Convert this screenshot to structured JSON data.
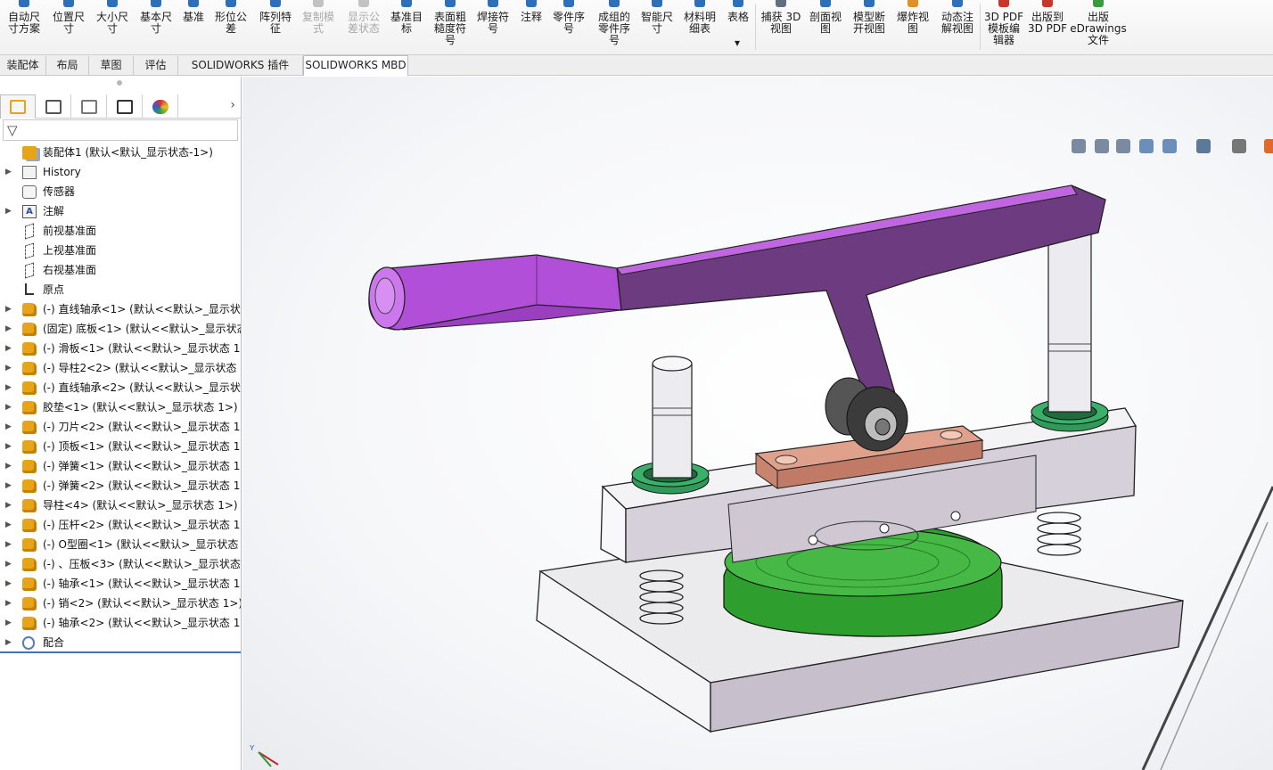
{
  "ribbon": {
    "buttons": [
      {
        "label": "自动尺\n寸方案",
        "icon": "auto-dimension-icon",
        "enabled": true
      },
      {
        "label": "位置尺\n寸",
        "icon": "location-dimension-icon",
        "enabled": true
      },
      {
        "label": "大小尺\n寸",
        "icon": "size-dimension-icon",
        "enabled": true
      },
      {
        "label": "基本尺\n寸",
        "icon": "basic-dimension-icon",
        "enabled": true
      },
      {
        "label": "基准",
        "icon": "datum-icon",
        "enabled": true
      },
      {
        "label": "形位公\n差",
        "icon": "geometric-tolerance-icon",
        "enabled": true
      },
      {
        "label": "阵列特\n征",
        "icon": "pattern-feature-icon",
        "enabled": true
      },
      {
        "label": "复制模\n式",
        "icon": "copy-scheme-icon",
        "enabled": false
      },
      {
        "label": "显示公\n差状态",
        "icon": "tolerance-status-icon",
        "enabled": false
      },
      {
        "label": "基准目\n标",
        "icon": "datum-target-icon",
        "enabled": true
      },
      {
        "label": "表面粗\n糙度符\n号",
        "icon": "surface-finish-icon",
        "enabled": true
      },
      {
        "label": "焊接符\n号",
        "icon": "weld-symbol-icon",
        "enabled": true
      },
      {
        "label": "注释",
        "icon": "note-icon",
        "enabled": true
      },
      {
        "label": "零件序\n号",
        "icon": "balloon-icon",
        "enabled": true
      },
      {
        "label": "成组的\n零件序\n号",
        "icon": "stacked-balloon-icon",
        "enabled": true
      },
      {
        "label": "智能尺\n寸",
        "icon": "smart-dimension-icon",
        "enabled": true
      },
      {
        "label": "材料明\n细表",
        "icon": "bom-icon",
        "enabled": true
      },
      {
        "label": "表格",
        "icon": "table-icon",
        "enabled": true
      },
      {
        "label": "捕获 3D\n视图",
        "icon": "capture-3d-view-icon",
        "enabled": true
      },
      {
        "label": "剖面视\n图",
        "icon": "section-view-icon",
        "enabled": true
      },
      {
        "label": "模型断\n开视图",
        "icon": "model-break-view-icon",
        "enabled": true
      },
      {
        "label": "爆炸视\n图",
        "icon": "exploded-view-icon",
        "enabled": true
      },
      {
        "label": "动态注\n解视图",
        "icon": "dynamic-annotation-view-icon",
        "enabled": true
      },
      {
        "label": "3D PDF\n模板编\n辑器",
        "icon": "pdf-template-editor-icon",
        "enabled": true
      },
      {
        "label": "出版到\n3D PDF",
        "icon": "publish-3d-pdf-icon",
        "enabled": true
      },
      {
        "label": "出版\neDrawings\n文件",
        "icon": "edrawings-icon",
        "enabled": true
      }
    ],
    "table_dropdown": "▾"
  },
  "tabs": [
    {
      "label": "装配体",
      "active": false
    },
    {
      "label": "布局",
      "active": false
    },
    {
      "label": "草图",
      "active": false
    },
    {
      "label": "评估",
      "active": false
    },
    {
      "label": "SOLIDWORKS 插件",
      "active": false
    },
    {
      "label": "SOLIDWORKS MBD",
      "active": true
    }
  ],
  "panel": {
    "tabs": [
      "feature-manager-icon",
      "property-manager-icon",
      "configuration-manager-icon",
      "dimxpert-manager-icon",
      "display-manager-icon"
    ],
    "more": "›",
    "filter_icon": "filter-icon"
  },
  "tree": [
    {
      "label": "装配体1  (默认<默认_显示状态-1>)",
      "icon": "asm",
      "expander": ""
    },
    {
      "label": "History",
      "icon": "folder",
      "expander": "▶"
    },
    {
      "label": "传感器",
      "icon": "sensor",
      "expander": ""
    },
    {
      "label": "注解",
      "icon": "annot",
      "expander": "▶"
    },
    {
      "label": "前视基准面",
      "icon": "plane",
      "expander": ""
    },
    {
      "label": "上视基准面",
      "icon": "plane",
      "expander": ""
    },
    {
      "label": "右视基准面",
      "icon": "plane",
      "expander": ""
    },
    {
      "label": "原点",
      "icon": "origin",
      "expander": ""
    },
    {
      "label": "(-) 直线轴承<1> (默认<<默认>_显示状态",
      "icon": "part",
      "expander": "▶"
    },
    {
      "label": "(固定) 底板<1> (默认<<默认>_显示状态",
      "icon": "part",
      "expander": "▶"
    },
    {
      "label": "(-) 滑板<1> (默认<<默认>_显示状态 1>",
      "icon": "part",
      "expander": "▶"
    },
    {
      "label": "(-) 导柱2<2> (默认<<默认>_显示状态 1",
      "icon": "part",
      "expander": "▶"
    },
    {
      "label": "(-) 直线轴承<2> (默认<<默认>_显示状态",
      "icon": "part",
      "expander": "▶"
    },
    {
      "label": "胶垫<1> (默认<<默认>_显示状态 1>)",
      "icon": "part",
      "expander": "▶"
    },
    {
      "label": "(-) 刀片<2> (默认<<默认>_显示状态 1>",
      "icon": "part",
      "expander": "▶"
    },
    {
      "label": "(-) 顶板<1> (默认<<默认>_显示状态 1>",
      "icon": "part",
      "expander": "▶"
    },
    {
      "label": "(-) 弹簧<1> (默认<<默认>_显示状态 1>",
      "icon": "part",
      "expander": "▶"
    },
    {
      "label": "(-) 弹簧<2> (默认<<默认>_显示状态 1>",
      "icon": "part",
      "expander": "▶"
    },
    {
      "label": "导柱<4> (默认<<默认>_显示状态 1>)",
      "icon": "part",
      "expander": "▶"
    },
    {
      "label": "(-) 压杆<2> (默认<<默认>_显示状态 1>",
      "icon": "part",
      "expander": "▶"
    },
    {
      "label": "(-) O型圈<1> (默认<<默认>_显示状态 1",
      "icon": "part",
      "expander": "▶"
    },
    {
      "label": "(-) 、压板<3> (默认<<默认>_显示状态 1",
      "icon": "part",
      "expander": "▶"
    },
    {
      "label": "(-) 轴承<1> (默认<<默认>_显示状态 1>",
      "icon": "part",
      "expander": "▶"
    },
    {
      "label": "(-) 销<2> (默认<<默认>_显示状态 1>)",
      "icon": "part",
      "expander": "▶"
    },
    {
      "label": "(-) 轴承<2> (默认<<默认>_显示状态 1>",
      "icon": "part",
      "expander": "▶"
    },
    {
      "label": "配合",
      "icon": "mate",
      "expander": "▶"
    }
  ],
  "headsup_toolbar": [
    "zoom-to-fit-icon",
    "zoom-to-area-icon",
    "previous-view-icon",
    "section-view-icon",
    "dynamic-annotation-icon",
    "view-orientation-icon",
    "display-style-icon",
    "hide-show-items-icon",
    "edit-appearance-icon",
    "apply-scene-icon",
    "view-settings-icon"
  ],
  "colors": {
    "handle": "#b14fd8",
    "lever": "#6d3c80",
    "base_plate": "#e6e6ea",
    "pad": "#2e9e2e",
    "copper": "#e0a18c",
    "bushing": "#2f9a5a"
  },
  "triad": {
    "y_label": "Y"
  }
}
